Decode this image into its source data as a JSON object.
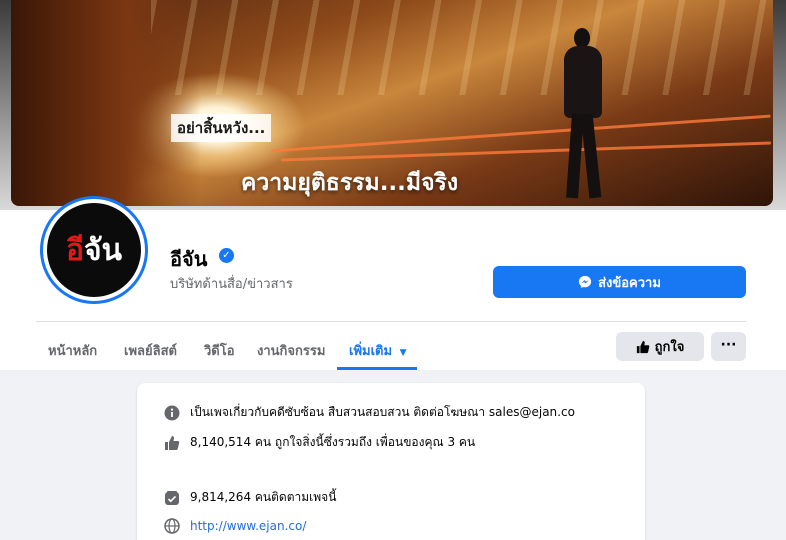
{
  "cover": {
    "tagline": "อย่าสิ้นหวัง...",
    "headline": "ความยุติธรรม...มีจริง"
  },
  "avatar": {
    "red_text": "อี",
    "white_text": "จัน"
  },
  "page": {
    "name": "อีจัน",
    "category": "บริษัทด้านสื่อ/ข่าวสาร"
  },
  "actions": {
    "message_label": "ส่งข้อความ",
    "like_label": "ถูกใจ",
    "more_label": "···"
  },
  "tabs": [
    {
      "label": "หน้าหลัก"
    },
    {
      "label": "เพลย์ลิสต์"
    },
    {
      "label": "วิดีโอ"
    },
    {
      "label": "งานกิจกรรม"
    },
    {
      "label": "เพิ่มเติม",
      "active": true
    }
  ],
  "about": {
    "description": "เป็นเพจเกี่ยวกับคดีซับซ้อน สืบสวนสอบสวน ติดต่อโฆษณา sales@ejan.co",
    "likes": "8,140,514 คน ถูกใจสิ่งนี้ซึ่งรวมถึง เพื่อนของคุณ 3 คน",
    "followers": "9,814,264 คนติดตามเพจนี้",
    "website": "http://www.ejan.co/"
  },
  "colors": {
    "accent": "#1877f2",
    "background": "#f0f2f5"
  }
}
